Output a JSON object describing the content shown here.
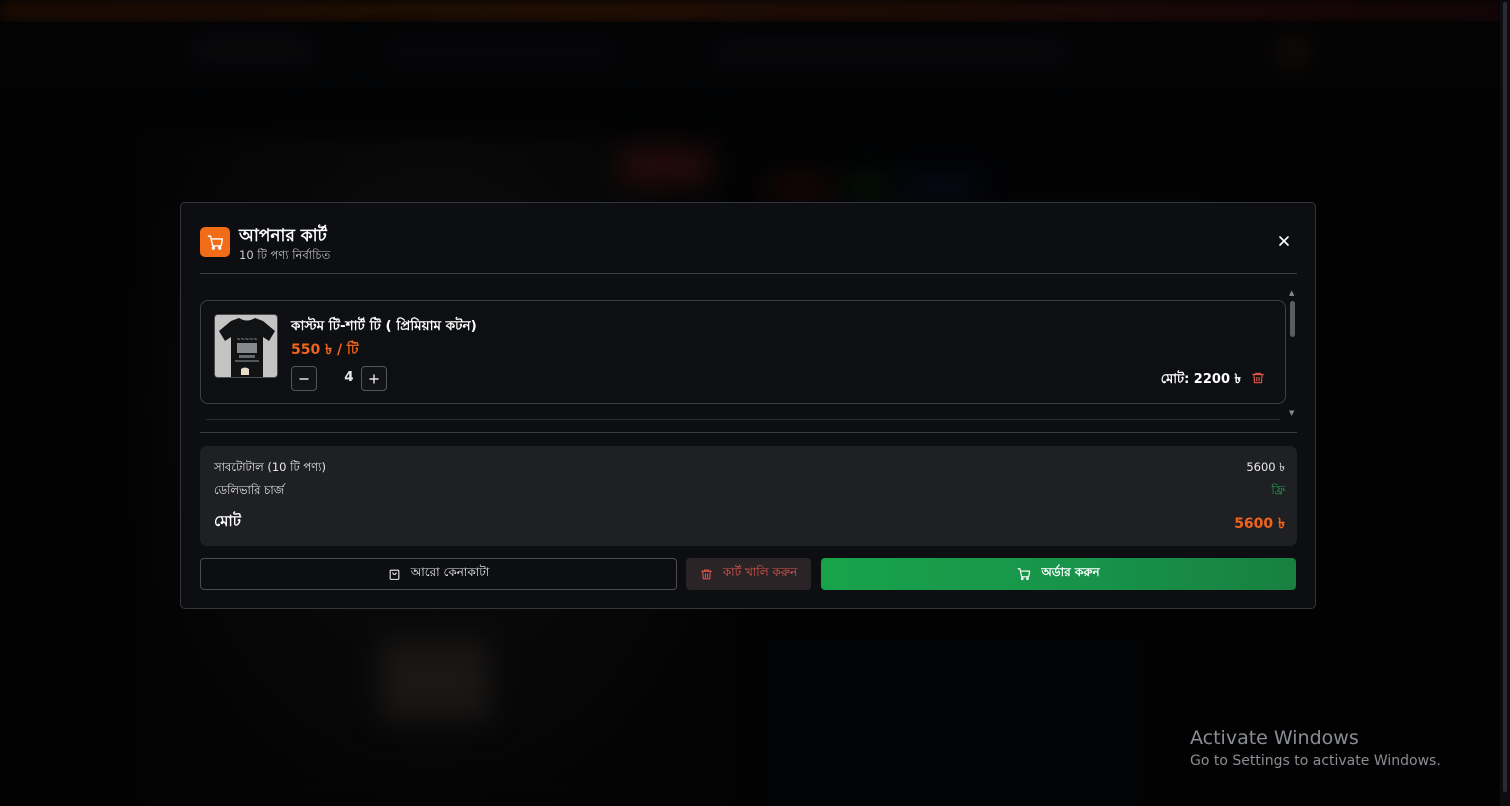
{
  "cart": {
    "title": "আপনার কার্ট",
    "subtitle": "10 টি পণ্য নির্বাচিত",
    "items": [
      {
        "name": "কাস্টম টি-শার্ট টি ( প্রিমিয়াম কটন)",
        "price": "550 ৳ / টি",
        "quantity": "4",
        "total": "মোট: 2200 ৳"
      }
    ],
    "summary": {
      "subtotal_label": "সাবটোটাল (10 টি পণ্য)",
      "subtotal_value": "5600 ৳",
      "delivery_label": "ডেলিভারি চার্জ",
      "delivery_value": "ফ্রি",
      "total_label": "মোট",
      "total_value": "5600 ৳"
    },
    "buttons": {
      "continue_shopping": "আরো কেনাকাটা",
      "clear_cart": "কার্ট খালি করুন",
      "place_order": "অর্ডার করুন"
    }
  },
  "watermark": {
    "title": "Activate Windows",
    "subtitle": "Go to Settings to activate Windows."
  },
  "colors": {
    "accent": "#f26b16",
    "price": "#f0641c",
    "order_button": "#18a34a",
    "danger": "#e2564a",
    "free": "#1fa64d"
  }
}
